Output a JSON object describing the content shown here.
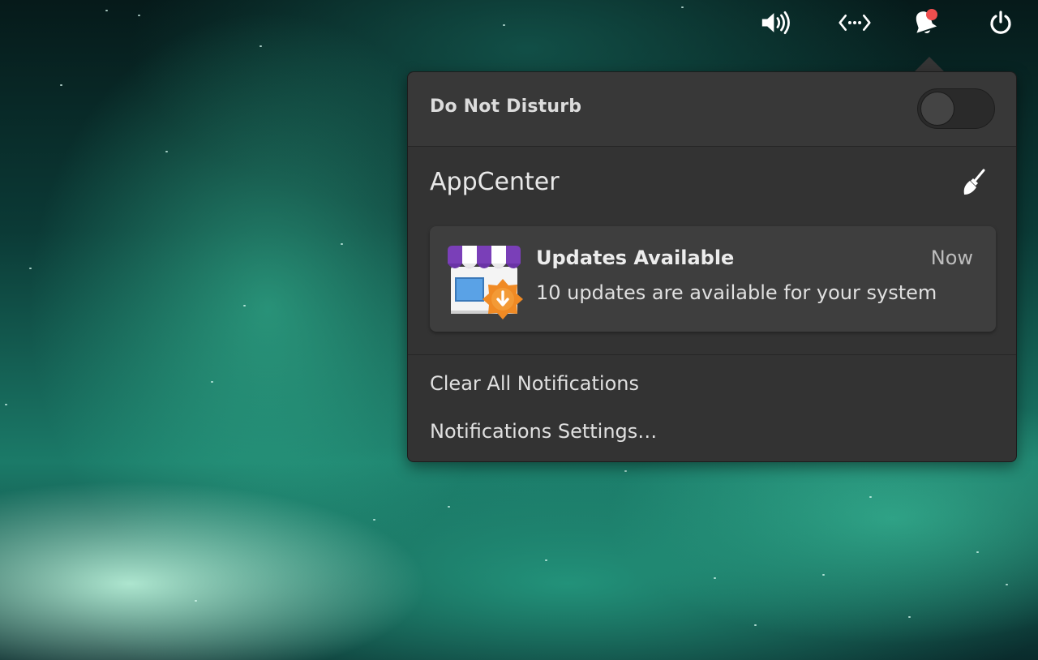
{
  "panel": {
    "indicators": [
      {
        "name": "sound-indicator",
        "icon": "speaker-volume-icon"
      },
      {
        "name": "network-indicator",
        "icon": "network-wired-icon"
      },
      {
        "name": "notifications-indicator",
        "icon": "bell-icon",
        "has_unread": true
      },
      {
        "name": "session-indicator",
        "icon": "power-icon"
      }
    ]
  },
  "popover": {
    "dnd": {
      "label": "Do Not Disturb",
      "enabled": false
    },
    "app_group": {
      "name": "AppCenter",
      "clear_icon": "broom-icon"
    },
    "notification": {
      "title": "Updates Available",
      "time": "Now",
      "body": "10 updates are available for your system",
      "icon": "appcenter-store-icon"
    },
    "menu": {
      "clear_all": "Clear All Notifications",
      "settings": "Notifications Settings…"
    }
  },
  "colors": {
    "popover_bg": "#333333",
    "badge_red": "#ef4e4e",
    "accent_orange": "#f08a24",
    "awning_purple": "#7a3fb8"
  }
}
